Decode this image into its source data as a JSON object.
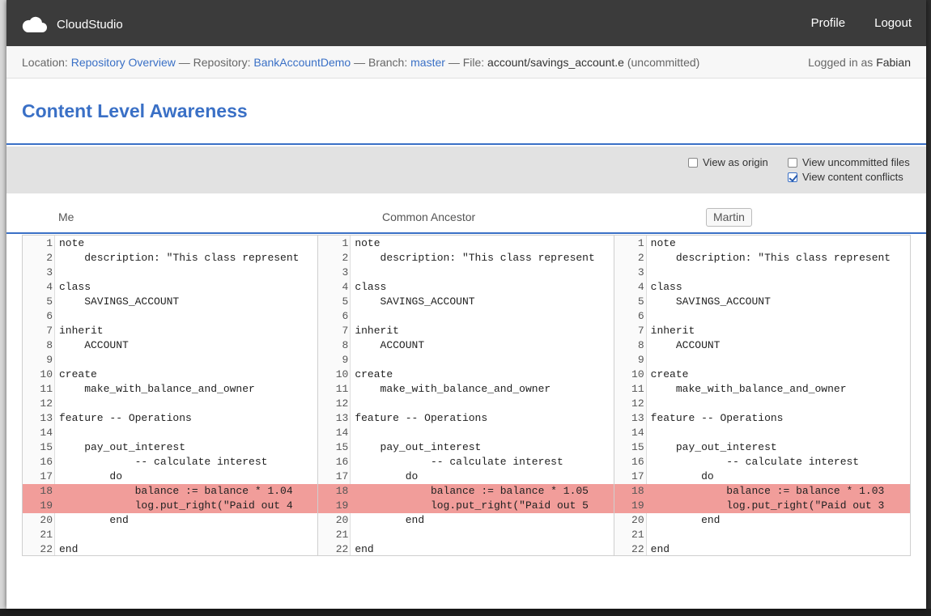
{
  "app": {
    "name": "CloudStudio"
  },
  "nav": {
    "profile": "Profile",
    "logout": "Logout"
  },
  "location": {
    "label": "Location:",
    "location_link": "Repository Overview",
    "repo_label": "— Repository:",
    "repo_link": "BankAccountDemo",
    "branch_label": "— Branch:",
    "branch_link": "master",
    "file_label": "— File:",
    "file_path": "account/savings_account.e",
    "status": "(uncommitted)",
    "logged_in_label": "Logged in as",
    "user": "Fabian"
  },
  "page": {
    "title": "Content Level Awareness"
  },
  "options": {
    "view_as_origin": {
      "label": "View as origin",
      "checked": false
    },
    "view_uncommitted": {
      "label": "View uncommitted files",
      "checked": false
    },
    "view_conflicts": {
      "label": "View content conflicts",
      "checked": true
    }
  },
  "columns": {
    "me": "Me",
    "ancestor": "Common Ancestor",
    "other": "Martin"
  },
  "panes": [
    {
      "name": "me",
      "lines": [
        {
          "n": "1",
          "t": "note"
        },
        {
          "n": "2",
          "t": "    description: \"This class represent"
        },
        {
          "n": "3",
          "t": ""
        },
        {
          "n": "4",
          "t": "class"
        },
        {
          "n": "5",
          "t": "    SAVINGS_ACCOUNT"
        },
        {
          "n": "6",
          "t": ""
        },
        {
          "n": "7",
          "t": "inherit"
        },
        {
          "n": "8",
          "t": "    ACCOUNT"
        },
        {
          "n": "9",
          "t": ""
        },
        {
          "n": "10",
          "t": "create"
        },
        {
          "n": "11",
          "t": "    make_with_balance_and_owner"
        },
        {
          "n": "12",
          "t": ""
        },
        {
          "n": "13",
          "t": "feature -- Operations"
        },
        {
          "n": "14",
          "t": ""
        },
        {
          "n": "15",
          "t": "    pay_out_interest"
        },
        {
          "n": "16",
          "t": "            -- calculate interest"
        },
        {
          "n": "17",
          "t": "        do"
        },
        {
          "n": "18",
          "t": "            balance := balance * 1.04",
          "conflict": true
        },
        {
          "n": "19",
          "t": "            log.put_right(\"Paid out 4",
          "conflict": true
        },
        {
          "n": "20",
          "t": "        end"
        },
        {
          "n": "21",
          "t": ""
        },
        {
          "n": "22",
          "t": "end"
        }
      ]
    },
    {
      "name": "ancestor",
      "lines": [
        {
          "n": "1",
          "t": "note"
        },
        {
          "n": "2",
          "t": "    description: \"This class represent"
        },
        {
          "n": "3",
          "t": ""
        },
        {
          "n": "4",
          "t": "class"
        },
        {
          "n": "5",
          "t": "    SAVINGS_ACCOUNT"
        },
        {
          "n": "6",
          "t": ""
        },
        {
          "n": "7",
          "t": "inherit"
        },
        {
          "n": "8",
          "t": "    ACCOUNT"
        },
        {
          "n": "9",
          "t": ""
        },
        {
          "n": "10",
          "t": "create"
        },
        {
          "n": "11",
          "t": "    make_with_balance_and_owner"
        },
        {
          "n": "12",
          "t": ""
        },
        {
          "n": "13",
          "t": "feature -- Operations"
        },
        {
          "n": "14",
          "t": ""
        },
        {
          "n": "15",
          "t": "    pay_out_interest"
        },
        {
          "n": "16",
          "t": "            -- calculate interest"
        },
        {
          "n": "17",
          "t": "        do"
        },
        {
          "n": "18",
          "t": "            balance := balance * 1.05",
          "conflict": true
        },
        {
          "n": "19",
          "t": "            log.put_right(\"Paid out 5",
          "conflict": true
        },
        {
          "n": "20",
          "t": "        end"
        },
        {
          "n": "21",
          "t": ""
        },
        {
          "n": "22",
          "t": "end"
        }
      ]
    },
    {
      "name": "other",
      "lines": [
        {
          "n": "1",
          "t": "note"
        },
        {
          "n": "2",
          "t": "    description: \"This class represent"
        },
        {
          "n": "3",
          "t": ""
        },
        {
          "n": "4",
          "t": "class"
        },
        {
          "n": "5",
          "t": "    SAVINGS_ACCOUNT"
        },
        {
          "n": "6",
          "t": ""
        },
        {
          "n": "7",
          "t": "inherit"
        },
        {
          "n": "8",
          "t": "    ACCOUNT"
        },
        {
          "n": "9",
          "t": ""
        },
        {
          "n": "10",
          "t": "create"
        },
        {
          "n": "11",
          "t": "    make_with_balance_and_owner"
        },
        {
          "n": "12",
          "t": ""
        },
        {
          "n": "13",
          "t": "feature -- Operations"
        },
        {
          "n": "14",
          "t": ""
        },
        {
          "n": "15",
          "t": "    pay_out_interest"
        },
        {
          "n": "16",
          "t": "            -- calculate interest"
        },
        {
          "n": "17",
          "t": "        do"
        },
        {
          "n": "18",
          "t": "            balance := balance * 1.03",
          "conflict": true
        },
        {
          "n": "19",
          "t": "            log.put_right(\"Paid out 3",
          "conflict": true
        },
        {
          "n": "20",
          "t": "        end"
        },
        {
          "n": "21",
          "t": ""
        },
        {
          "n": "22",
          "t": "end"
        }
      ]
    }
  ],
  "colors": {
    "accent": "#3a70c6",
    "navbar": "#3b3b3b",
    "conflict": "#f19d9a"
  }
}
